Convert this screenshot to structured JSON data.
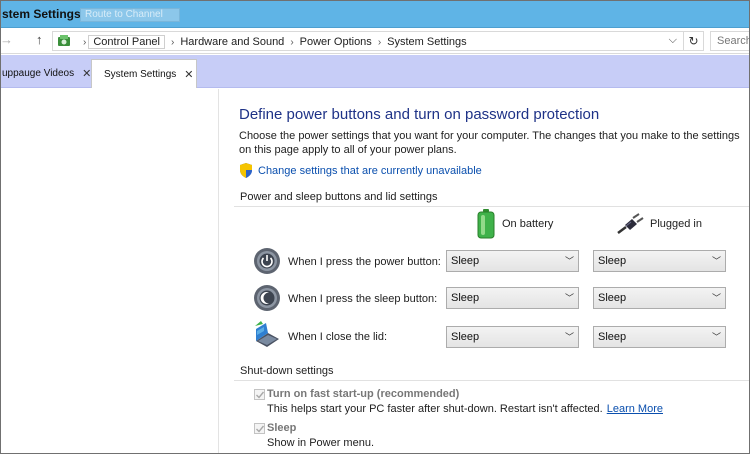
{
  "window": {
    "title": "stem Settings",
    "ghost_button": "Route to Channel"
  },
  "address": {
    "crumbs": [
      "Control Panel",
      "Hardware and Sound",
      "Power Options",
      "System Settings"
    ],
    "search_placeholder": "Search",
    "refresh_glyph": "↻",
    "dropdown_glyph": "⌵"
  },
  "tabs": [
    {
      "label": "uppauge Videos"
    },
    {
      "label": "System Settings"
    }
  ],
  "content": {
    "heading": "Define power buttons and turn on password protection",
    "description": "Choose the power settings that you want for your computer. The changes that you make to the settings on this page apply to all of your power plans.",
    "change_link": "Change settings that are currently unavailable",
    "section_buttons": "Power and sleep buttons and lid settings",
    "col_battery": "On battery",
    "col_plugged": "Plugged in",
    "rows": [
      {
        "label": "When I press the power button:",
        "battery": "Sleep",
        "plugged": "Sleep"
      },
      {
        "label": "When I press the sleep button:",
        "battery": "Sleep",
        "plugged": "Sleep"
      },
      {
        "label": "When I close the lid:",
        "battery": "Sleep",
        "plugged": "Sleep"
      }
    ],
    "section_shutdown": "Shut-down settings",
    "fast_startup": {
      "label": "Turn on fast start-up (recommended)",
      "sub": "This helps start your PC faster after shut-down. Restart isn't affected.",
      "link": "Learn More",
      "checked": true
    },
    "sleep": {
      "label": "Sleep",
      "sub": "Show in Power menu.",
      "checked": true
    }
  },
  "colors": {
    "accent_link": "#0a4fae",
    "heading": "#1e3287",
    "tabbar": "#c7cdf7",
    "titlebar": "#5fb4e6"
  },
  "icons": [
    "control-panel-icon",
    "shield-icon",
    "battery-icon",
    "plug-icon",
    "power-button-icon",
    "sleep-button-icon",
    "lid-icon",
    "chevron-down-icon",
    "close-icon",
    "refresh-icon"
  ]
}
